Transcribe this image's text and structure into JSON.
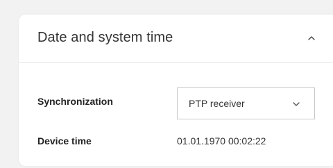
{
  "panel": {
    "title": "Date and system time",
    "collapse_icon": "chevron-up-icon"
  },
  "fields": {
    "synchronization": {
      "label": "Synchronization",
      "selected_value": "PTP receiver",
      "dropdown_icon": "chevron-down-icon"
    },
    "device_time": {
      "label": "Device time",
      "value": "01.01.1970 00:02:22"
    }
  },
  "colors": {
    "page_background": "#f2f2f2",
    "card_background": "#ffffff",
    "divider": "#e2e2e2",
    "select_border": "#c8c8c8"
  }
}
